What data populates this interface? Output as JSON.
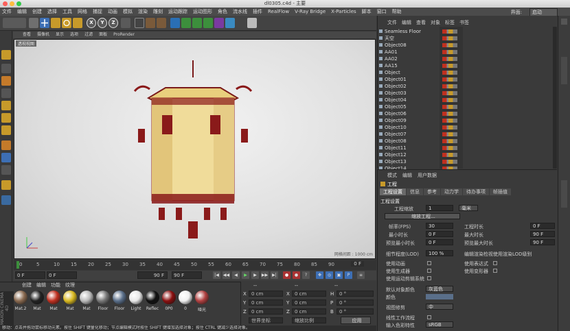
{
  "window": {
    "title": "dl0305.c4d - 主要"
  },
  "menu": [
    "文件",
    "编辑",
    "创建",
    "选择",
    "工具",
    "网格",
    "捕捉",
    "动画",
    "模拟",
    "渲染",
    "雕刻",
    "运动跟踪",
    "运动图形",
    "角色",
    "流水线",
    "插件",
    "RealFlow",
    "V-Ray Bridge",
    "X-Particles",
    "脚本",
    "窗口",
    "帮助"
  ],
  "interface": {
    "label": "界面:",
    "value": "启动"
  },
  "viewport": {
    "menu": [
      "查看",
      "摄像机",
      "显示",
      "选项",
      "过滤",
      "面板",
      "ProRender"
    ],
    "label": "透视视图",
    "grid": "网格间距 : 1000 cm"
  },
  "timeline": {
    "ticks": [
      "0",
      "5",
      "10",
      "15",
      "20",
      "25",
      "30",
      "35",
      "40",
      "45",
      "50",
      "55",
      "60",
      "65",
      "70",
      "75",
      "80",
      "85",
      "90"
    ],
    "end": "0 F"
  },
  "transport": {
    "start": "0 F",
    "current": "0 F",
    "end": "90 F",
    "max": "90 F"
  },
  "materials": {
    "menu": [
      "创建",
      "编辑",
      "功能",
      "纹理"
    ],
    "items": [
      {
        "label": "Mat.2",
        "color": "#8a6a50"
      },
      {
        "label": "Mat",
        "color": "#222222"
      },
      {
        "label": "Mat",
        "color": "#c03020"
      },
      {
        "label": "Mat",
        "color": "#d8b820"
      },
      {
        "label": "Mat",
        "color": "#bbbbbb"
      },
      {
        "label": "Floor",
        "color": "#777777"
      },
      {
        "label": "Floor",
        "color": "#5a6f8a"
      },
      {
        "label": "Light",
        "color": "#e8e8e8"
      },
      {
        "label": "Reflec",
        "color": "#111111"
      },
      {
        "label": "0P0",
        "color": "#8a1010"
      },
      {
        "label": "0",
        "color": "#f0f0f0"
      },
      {
        "label": "哑光",
        "color": "#b04040"
      }
    ]
  },
  "coords": {
    "header": [
      "--",
      "--",
      "--"
    ],
    "rows": [
      {
        "axis": "X",
        "val": "0 cm",
        "axis2": "X",
        "val2": "0 cm",
        "axis3": "H",
        "val3": "0 °"
      },
      {
        "axis": "Y",
        "val": "0 cm",
        "axis2": "Y",
        "val2": "0 cm",
        "axis3": "P",
        "val3": "0 °"
      },
      {
        "axis": "Z",
        "val": "0 cm",
        "axis2": "Z",
        "val2": "0 cm",
        "axis3": "B",
        "val3": "0 °"
      }
    ],
    "mode1": "世界坐标",
    "mode2": "缩放比例",
    "apply": "应用"
  },
  "objects": {
    "menu": [
      "文件",
      "编辑",
      "查看",
      "对象",
      "标签",
      "书签"
    ],
    "items": [
      "Seamless Floor",
      "天空",
      "Object08",
      "AA01",
      "AA02",
      "AA15",
      "Object",
      "Object01",
      "Object02",
      "Object03",
      "Object04",
      "Object05",
      "Object06",
      "Object09",
      "Object10",
      "Object07",
      "Object08",
      "Object11",
      "Object12",
      "Object13",
      "Object14"
    ]
  },
  "attributes": {
    "menu": [
      "模式",
      "编辑",
      "用户数据"
    ],
    "title": "工程",
    "tabs": [
      "工程设置",
      "信息",
      "参考",
      "动力学",
      "待办事项",
      "帧插值"
    ],
    "section": "工程设置",
    "scale_label": "工程缩放",
    "scale_val": "1",
    "scale_unit": "毫米",
    "scale_btn": "缩放工程...",
    "fps_label": "帧率(FPS)",
    "fps": "30",
    "min_label": "最小时长",
    "min": "0 F",
    "pmin_label": "预览最小时长",
    "pmin": "0 F",
    "dur_label": "工程时长",
    "dur": "0 F",
    "max_label": "最大时长",
    "max": "90 F",
    "pmax_label": "预览最大时长",
    "pmax": "90 F",
    "lod_label": "细节程度(LOD)",
    "lod": "100 %",
    "lod_opt": "编辑渲染检视使用渲染LOD级别",
    "anim": "使用动画",
    "expr": "使用表达式",
    "gen": "使用生成器",
    "deform": "使用变形器",
    "motion": "使用运动剪辑系统",
    "defcolor_label": "默认对象颜色",
    "defcolor": "灰蓝色",
    "color_label": "颜色",
    "clip_label": "视图修剪",
    "clip": "中",
    "lin_label": "线性工作流程",
    "input_label": "输入色彩特性",
    "input": "sRGB"
  },
  "status": "移动：点击并拖动鼠标移动元素。按住 SHIFT 键量化移动；节点编辑模式时按住 SHIFT 键增加选择对象；按住 CTRL 键减少选择对象。",
  "colors": {
    "accent": "#3d6fb5",
    "lantern_yellow": "#f0dc9a",
    "lantern_red": "#8a1a1a"
  }
}
